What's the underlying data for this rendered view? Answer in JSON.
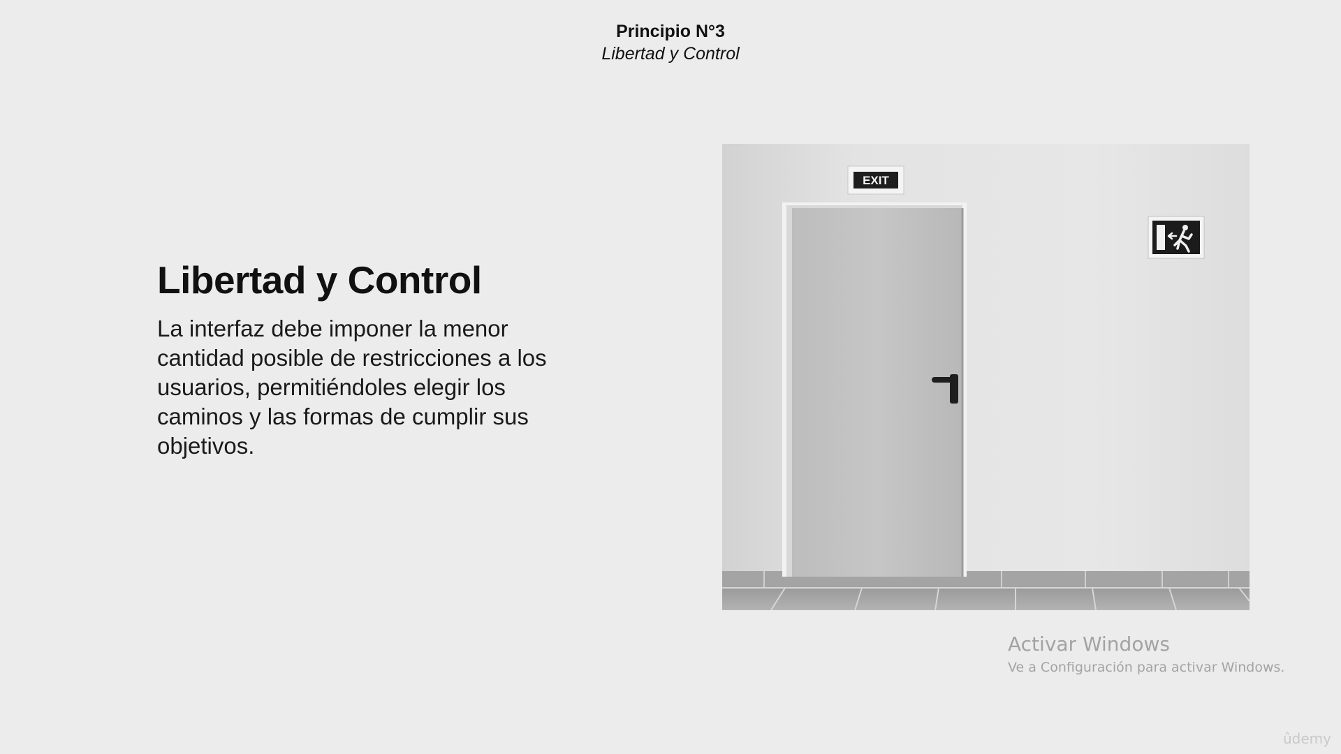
{
  "header": {
    "title": "Principio N°3",
    "subtitle": "Libertad y Control"
  },
  "content": {
    "heading": "Libertad y Control",
    "body": "La interfaz debe imponer la menor cantidad posible de restricciones a los usuarios, permitiéndoles elegir los caminos y las formas de cumplir sus objetivos."
  },
  "photo": {
    "exit_sign_text": "EXIT",
    "icons": [
      "exit-sign-icon",
      "emergency-exit-pictogram-icon",
      "door-handle-icon"
    ]
  },
  "watermark": {
    "title": "Activar Windows",
    "subtitle": "Ve a Configuración para activar Windows."
  },
  "brand": {
    "logo_text": "ûdemy"
  },
  "colors": {
    "background": "#ececec",
    "text": "#111111",
    "watermark": "#a3a3a3"
  }
}
